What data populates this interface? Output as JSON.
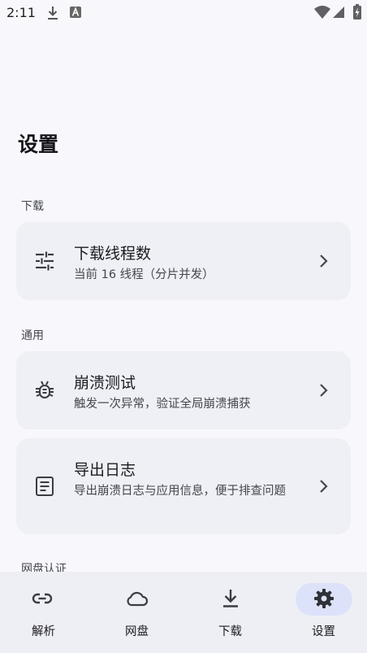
{
  "status_bar": {
    "time": "2:11",
    "icons": [
      "download-icon",
      "a-notification-icon",
      "wifi-icon",
      "signal-icon",
      "battery-charging-icon"
    ]
  },
  "page": {
    "title": "设置"
  },
  "sections": [
    {
      "label": "下载",
      "items": [
        {
          "icon": "tune-icon",
          "title": "下载线程数",
          "subtitle": "当前 16 线程（分片并发）"
        }
      ]
    },
    {
      "label": "通用",
      "items": [
        {
          "icon": "bug-icon",
          "title": "崩溃测试",
          "subtitle": "触发一次异常，验证全局崩溃捕获"
        },
        {
          "icon": "article-icon",
          "title": "导出日志",
          "subtitle": "导出崩溃日志与应用信息，便于排查问题"
        }
      ]
    },
    {
      "label": "网盘认证"
    }
  ],
  "bottom_nav": {
    "selected": "设置",
    "items": [
      {
        "icon": "link-icon",
        "label": "解析"
      },
      {
        "icon": "cloud-icon",
        "label": "网盘"
      },
      {
        "icon": "download-icon",
        "label": "下载"
      },
      {
        "icon": "gear-icon",
        "label": "设置"
      }
    ]
  },
  "colors": {
    "background": "#f8f8fc",
    "card": "#eef0f5",
    "nav_background": "#eeeff4",
    "active_pill": "#dce2f9"
  }
}
